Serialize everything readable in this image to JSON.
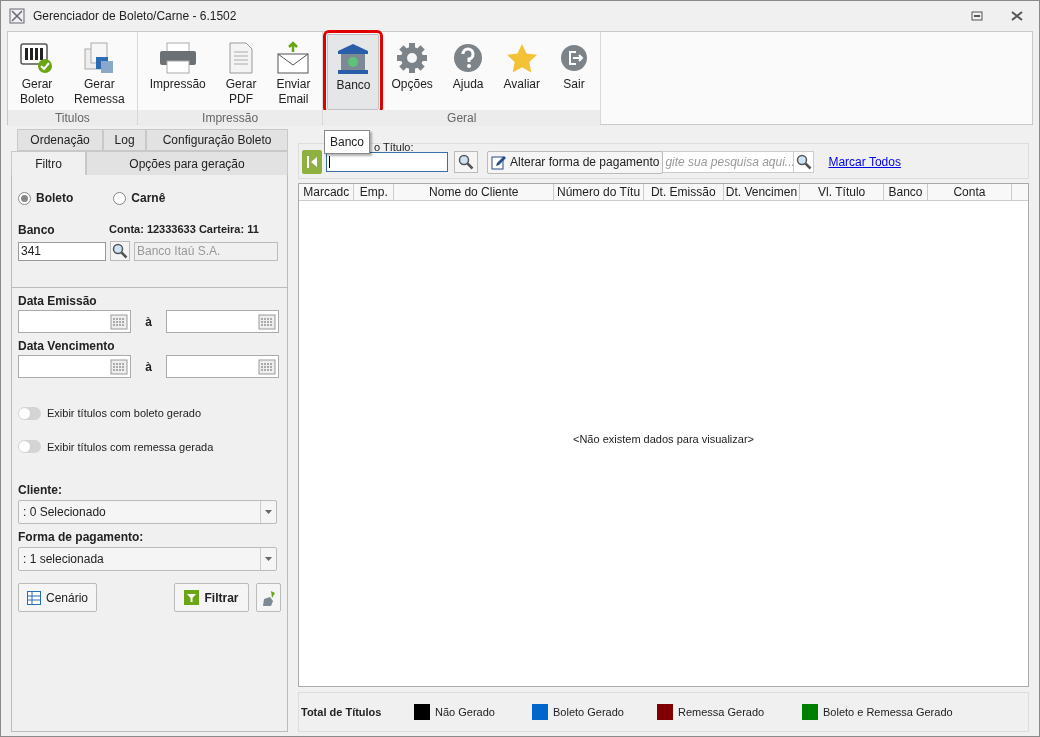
{
  "window": {
    "title": "Gerenciador de Boleto/Carne - 6.1502"
  },
  "ribbon": {
    "groups": [
      {
        "label": "Titulos",
        "buttons": [
          {
            "kind": "barcode",
            "lines": [
              "Gerar",
              "Boleto"
            ],
            "selected": false
          },
          {
            "kind": "remessa",
            "lines": [
              "Gerar",
              "Remessa"
            ],
            "selected": false
          }
        ]
      },
      {
        "label": "Impressão",
        "buttons": [
          {
            "kind": "printer",
            "lines": [
              "Impressão"
            ],
            "selected": false
          },
          {
            "kind": "pdf",
            "lines": [
              "Gerar",
              "PDF"
            ],
            "selected": false
          },
          {
            "kind": "email",
            "lines": [
              "Enviar",
              "Email"
            ],
            "selected": false
          }
        ]
      },
      {
        "label": "Geral",
        "buttons": [
          {
            "kind": "bank",
            "lines": [
              "Banco"
            ],
            "selected": true
          },
          {
            "kind": "gear",
            "lines": [
              "Opções"
            ],
            "selected": false
          },
          {
            "kind": "help",
            "lines": [
              "Ajuda"
            ],
            "selected": false
          },
          {
            "kind": "star",
            "lines": [
              "Avaliar"
            ],
            "selected": false
          },
          {
            "kind": "exit",
            "lines": [
              "Sair"
            ],
            "selected": false
          }
        ]
      }
    ]
  },
  "tooltip": "Banco",
  "left_panel": {
    "tabs_back": [
      {
        "label": "Ordenação",
        "selected": false
      },
      {
        "label": "Log",
        "selected": false
      },
      {
        "label": "Configuração Boleto",
        "selected": false
      }
    ],
    "tabs_front": [
      {
        "label": "Filtro",
        "selected": true
      },
      {
        "label": "Opções para geração",
        "selected": false
      }
    ],
    "radios": [
      {
        "label": "Boleto",
        "selected": true
      },
      {
        "label": "Carnê",
        "selected": false
      }
    ],
    "banco_label": "Banco",
    "conta_info": "Conta: 12333633 Carteira: 11",
    "banco_code": "341",
    "banco_name": "Banco Itaú S.A.",
    "date_ranges": [
      {
        "label": "Data Emissão",
        "separator": "à"
      },
      {
        "label": "Data Vencimento",
        "separator": "à"
      }
    ],
    "toggles": [
      {
        "label": "Exibir títulos com boleto gerado",
        "on": false
      },
      {
        "label": "Exibir títulos com remessa gerada",
        "on": false
      }
    ],
    "dropdowns": [
      {
        "label": "Cliente:",
        "value": ": 0 Selecionado"
      },
      {
        "label": "Forma de pagamento:",
        "value": ": 1 selecionada"
      }
    ],
    "cenario_button": "Cenário",
    "filtrar_button": "Filtrar"
  },
  "search_bar": {
    "label": "o Título:",
    "alterar_button": "Alterar forma de pagamento",
    "placeholder": "gite sua pesquisa aqui...",
    "marcar_link": "Marcar Todos"
  },
  "table": {
    "columns": [
      "Marcadc",
      "Emp.",
      "Nome do Cliente",
      "Número do Títu",
      "Dt. Emissão",
      "Dt. Vencimen",
      "Vl. Título",
      "Banco",
      "Conta"
    ],
    "empty_message": "<Não existem dados para visualizar>"
  },
  "legend": {
    "title": "Total de Títulos",
    "items": [
      {
        "label": "Não Gerado",
        "color": "#000000"
      },
      {
        "label": "Boleto Gerado",
        "color": "#0066cc"
      },
      {
        "label": "Remessa Gerado",
        "color": "#800000"
      },
      {
        "label": "Boleto e Remessa Gerado",
        "color": "#008000"
      }
    ]
  }
}
